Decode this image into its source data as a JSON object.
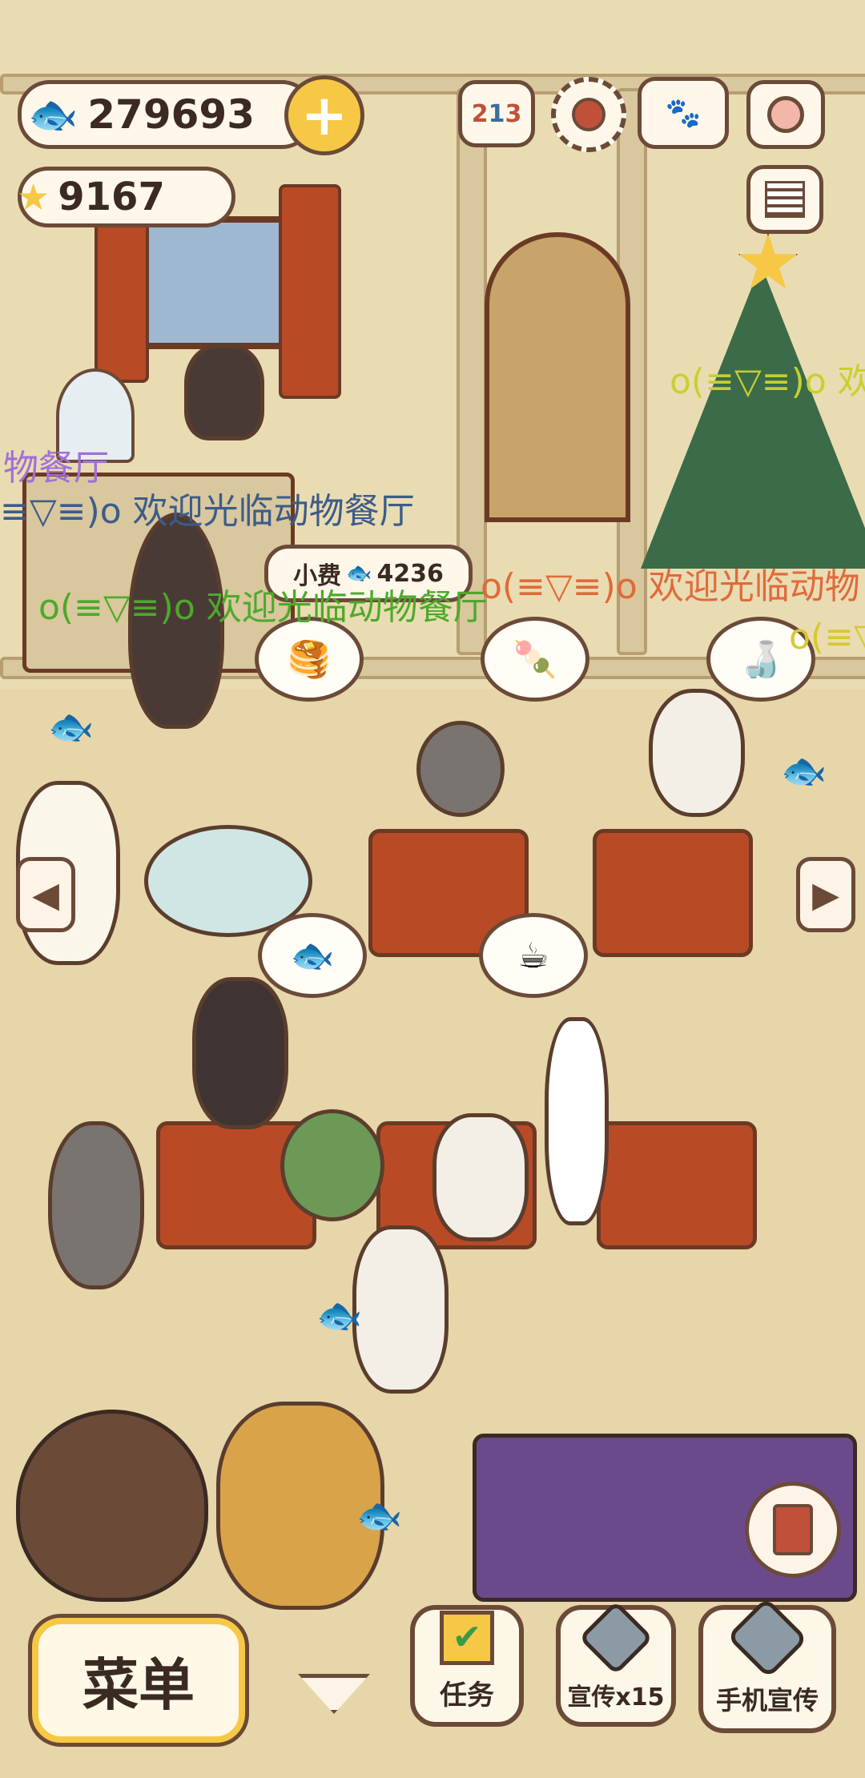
{
  "hud": {
    "fish_count": "279693",
    "star_count": "9167",
    "add_icon": "plus-icon",
    "top_icons": [
      "ranking-icon",
      "settings-gear-icon",
      "paw-book-icon",
      "camera-icon",
      "newspaper-icon"
    ]
  },
  "tip_bubble": {
    "label": "小费",
    "amount": "4236"
  },
  "danmaku": [
    {
      "text": "物餐厅",
      "color": "#a070d8"
    },
    {
      "text": "≡▽≡)o 欢迎光临动物餐厅",
      "color": "#3c5c8a"
    },
    {
      "text": "o(≡▽≡)o 欢迎光临动物餐厅",
      "color": "#4caa2a"
    },
    {
      "text": "o(≡▽≡)o 欢迎光临动物",
      "color": "#e06a3a"
    },
    {
      "text": "o(≡▽≡)o 欢",
      "color": "#c8d030"
    },
    {
      "text": "o(≡▽",
      "color": "#d8c830"
    }
  ],
  "bottom_bar": {
    "menu_label": "菜单",
    "task_label": "任务",
    "promo_label": "宣传x15",
    "phone_promo_label": "手机宣传"
  },
  "colors": {
    "accent_yellow": "#f6c846",
    "outline_brown": "#6b4a38",
    "table_red": "#b84a26"
  }
}
